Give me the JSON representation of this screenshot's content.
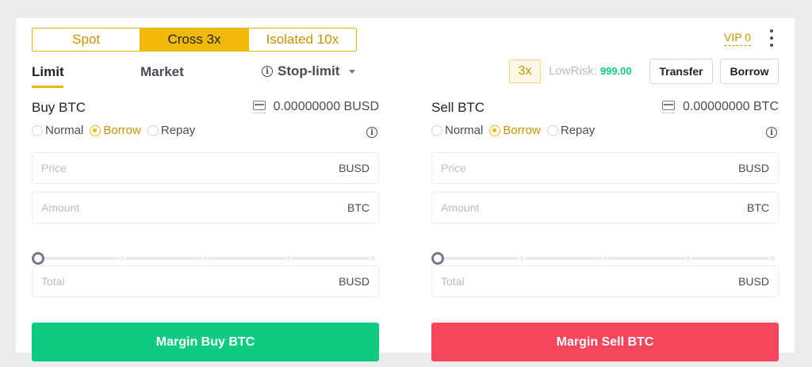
{
  "mode_tabs": [
    {
      "label": "Spot",
      "active": false
    },
    {
      "label": "Cross 3x",
      "active": true
    },
    {
      "label": "Isolated 10x",
      "active": false
    }
  ],
  "vip_label": "VIP 0",
  "order_tabs": {
    "limit": "Limit",
    "market": "Market",
    "stop_limit": "Stop-limit"
  },
  "leverage_badge": "3x",
  "risk": {
    "label": "LowRisk:",
    "value": "999.00"
  },
  "transfer_label": "Transfer",
  "borrow_label": "Borrow",
  "buy": {
    "title": "Buy BTC",
    "balance": "0.00000000 BUSD",
    "radios": [
      "Normal",
      "Borrow",
      "Repay"
    ],
    "selected_radio": "Borrow",
    "price": {
      "placeholder": "Price",
      "unit": "BUSD"
    },
    "amount": {
      "placeholder": "Amount",
      "unit": "BTC"
    },
    "total": {
      "placeholder": "Total",
      "unit": "BUSD"
    },
    "slider_value_pct": 0,
    "button_label": "Margin Buy BTC"
  },
  "sell": {
    "title": "Sell BTC",
    "balance": "0.00000000 BTC",
    "radios": [
      "Normal",
      "Borrow",
      "Repay"
    ],
    "selected_radio": "Borrow",
    "price": {
      "placeholder": "Price",
      "unit": "BUSD"
    },
    "amount": {
      "placeholder": "Amount",
      "unit": "BTC"
    },
    "total": {
      "placeholder": "Total",
      "unit": "BUSD"
    },
    "slider_value_pct": 0,
    "button_label": "Margin Sell BTC"
  },
  "colors": {
    "accent": "#f0b90b",
    "buy": "#0ecb81",
    "sell": "#f6465d",
    "risk_value": "#0ecb81"
  },
  "icons": {
    "more": "more-vertical-icon",
    "info": "info-icon",
    "wallet": "wallet-icon",
    "dropdown": "chevron-down-icon"
  }
}
